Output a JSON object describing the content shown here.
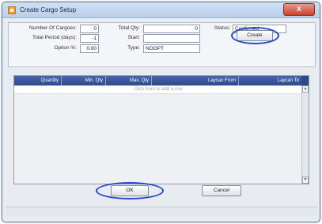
{
  "window": {
    "title": "Create Cargo Setup",
    "close_label": "x"
  },
  "form": {
    "number_of_cargoes": {
      "label": "Number Of Cargoes:",
      "value": "0"
    },
    "total_period": {
      "label": "Total Period (days):",
      "value": "-1"
    },
    "option_pct": {
      "label": "Option %:",
      "value": "0.00"
    },
    "total_qty": {
      "label": "Total Qty:",
      "value": "0"
    },
    "start": {
      "label": "Start:",
      "value": ""
    },
    "type": {
      "label": "Type:",
      "value": "NOOPT"
    },
    "status": {
      "label": "Status:",
      "value": "Confirmed"
    }
  },
  "buttons": {
    "create": "Create",
    "ok": "OK",
    "cancel": "Cancel"
  },
  "grid": {
    "columns": [
      "Quantity",
      "Min. Qty",
      "Max. Qty",
      "Laycan From",
      "Laycan To"
    ],
    "add_row_hint": "Click here to add a row"
  },
  "colors": {
    "grid_header": "#2d4a88",
    "annotation_ring": "#2348c8",
    "close_button": "#c8432f"
  },
  "icons": {
    "app": "cargo-setup-icon",
    "close": "close-icon",
    "scroll_up": "scroll-up-arrow-icon",
    "scroll_down": "scroll-down-arrow-icon"
  }
}
